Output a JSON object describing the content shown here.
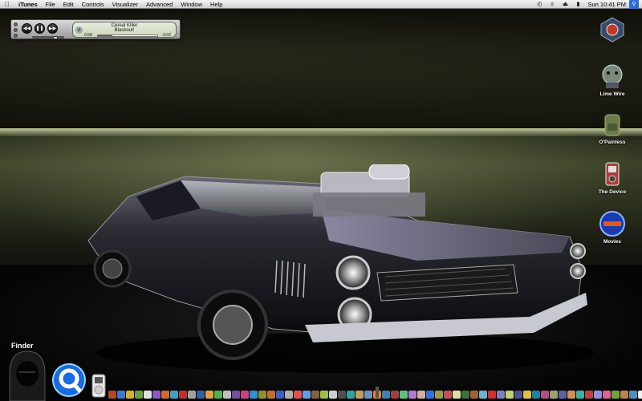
{
  "menubar": {
    "apple_icon": "apple-icon",
    "app_name": "iTunes",
    "items": [
      "File",
      "Edit",
      "Controls",
      "Visualizer",
      "Advanced",
      "Window",
      "Help"
    ],
    "clock": "Sun 10:41 PM",
    "status_icons": [
      "airport-icon",
      "volume-icon",
      "eject-icon",
      "battery-icon"
    ]
  },
  "mini_player": {
    "song": "Cereal Killer",
    "artist": "Blackout!",
    "elapsed": "0:58",
    "remaining": "-3:02",
    "progress": 0.24
  },
  "desktop_icons": [
    {
      "label": "",
      "icon": "hard-drive-icon"
    },
    {
      "label": "Lime Wire",
      "icon": "limewire-icon"
    },
    {
      "label": "O'Painless",
      "icon": "backpack-icon"
    },
    {
      "label": "The Device",
      "icon": "device-icon"
    },
    {
      "label": "Movies",
      "icon": "movies-icon"
    }
  ],
  "dock": {
    "finder_label": "Finder",
    "mini_icon_colors": [
      "#b04a2a",
      "#3a7ad0",
      "#d8b030",
      "#6aa040",
      "#e0e0e0",
      "#8a5ac0",
      "#d06a30",
      "#40a0c0",
      "#c03030",
      "#a0a0a0",
      "#3060a0",
      "#e0a040",
      "#50b050",
      "#c0c0c0",
      "#7050a0",
      "#d04080",
      "#3090d0",
      "#909030",
      "#c07030",
      "#4060c0",
      "#b0b0b0",
      "#e05050",
      "#60a0e0",
      "#806040",
      "#a0c040",
      "#d0d0d0",
      "#505050",
      "#30a0a0",
      "#c0a060",
      "#7090c0",
      "#e08030",
      "#4080b0",
      "#a04040",
      "#60c080",
      "#b07ad0",
      "#d0b0a0",
      "#3070e0",
      "#90a050",
      "#c05060",
      "#e0e0a0",
      "#407040",
      "#a06030",
      "#70b0d0",
      "#d03030",
      "#8080c0",
      "#c0d070",
      "#505090",
      "#e0c040",
      "#2080a0",
      "#b05080",
      "#a0a070",
      "#6060a0",
      "#d09050",
      "#40b0a0",
      "#c04040",
      "#9090e0",
      "#e06090",
      "#70a040",
      "#c08050",
      "#5090c0",
      "#f0f0f0",
      "#a0c0e0",
      "#d0a030"
    ]
  }
}
